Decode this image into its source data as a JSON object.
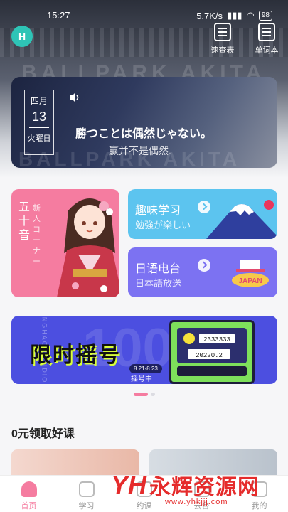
{
  "status_bar": {
    "time": "15:27",
    "network": "5.7K/s",
    "battery": "98"
  },
  "app_logo": "H",
  "top_actions": [
    {
      "label": "速查表",
      "icon": "dictionary-icon"
    },
    {
      "label": "单词本",
      "icon": "wordbook-icon"
    }
  ],
  "hero_bg_text": "BALLPARK AKITA",
  "daily_quote": {
    "month": "四月",
    "day": "13",
    "weekday": "火曜日",
    "jp": "勝つことは偶然じゃない。",
    "cn": "赢并不是偶然."
  },
  "features": {
    "beginner": {
      "title": "五十音",
      "subtitle": "新人コーナー"
    },
    "fun": {
      "title": "趣味学习",
      "subtitle": "勉強が楽しい"
    },
    "radio": {
      "title": "日语电台",
      "subtitle": "日本語放送",
      "badge": "JAPAN"
    }
  },
  "promo": {
    "title": "限时摇号",
    "side_text": "LANGHAO STUDIO",
    "dates": "8.21-8.23",
    "status": "摇号中",
    "counter": "2333333",
    "machine_text": "20220.2"
  },
  "section": {
    "title": "0元领取好课"
  },
  "tabs": [
    {
      "label": "首页",
      "active": true
    },
    {
      "label": "学习",
      "active": false
    },
    {
      "label": "约课",
      "active": false
    },
    {
      "label": "云台",
      "active": false
    },
    {
      "label": "我的",
      "active": false
    }
  ],
  "watermark": {
    "logo": "YH",
    "name": "永辉资源网",
    "url": "www.yhkjjj.com"
  },
  "colors": {
    "accent": "#f57ca0",
    "blue": "#5cc4ef",
    "violet": "#7c72f2",
    "promo": "#4c4fe0"
  }
}
